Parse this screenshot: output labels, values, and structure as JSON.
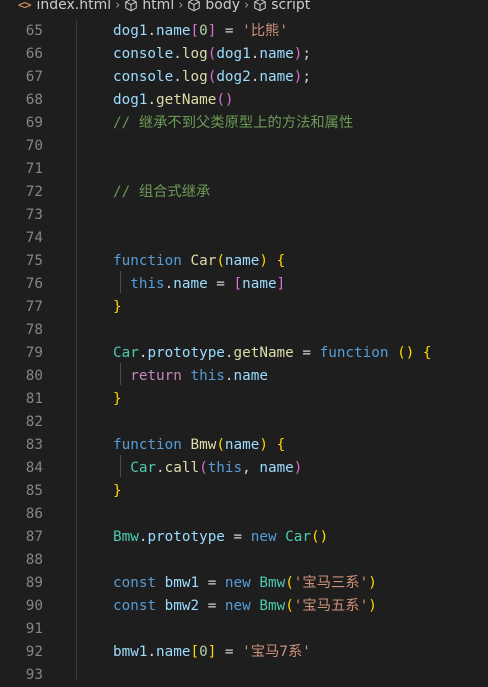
{
  "breadcrumb": {
    "file": "index.html",
    "html": "html",
    "body": "body",
    "script": "script",
    "file_icon": "code-angle-brackets-icon",
    "element_icon": "cube-icon"
  },
  "editor": {
    "lines": [
      {
        "n": "65",
        "tokens": [
          [
            "var",
            "dog1"
          ],
          [
            "plain",
            "."
          ],
          [
            "var",
            "name"
          ],
          [
            "br2",
            "["
          ],
          [
            "num",
            "0"
          ],
          [
            "br2",
            "]"
          ],
          [
            "plain",
            " = "
          ],
          [
            "str",
            "'比熊'"
          ]
        ]
      },
      {
        "n": "66",
        "tokens": [
          [
            "var",
            "console"
          ],
          [
            "plain",
            "."
          ],
          [
            "fn",
            "log"
          ],
          [
            "br2",
            "("
          ],
          [
            "var",
            "dog1"
          ],
          [
            "plain",
            "."
          ],
          [
            "var",
            "name"
          ],
          [
            "br2",
            ")"
          ],
          [
            "plain",
            ";"
          ]
        ]
      },
      {
        "n": "67",
        "tokens": [
          [
            "var",
            "console"
          ],
          [
            "plain",
            "."
          ],
          [
            "fn",
            "log"
          ],
          [
            "br2",
            "("
          ],
          [
            "var",
            "dog2"
          ],
          [
            "plain",
            "."
          ],
          [
            "var",
            "name"
          ],
          [
            "br2",
            ")"
          ],
          [
            "plain",
            ";"
          ]
        ]
      },
      {
        "n": "68",
        "tokens": [
          [
            "var",
            "dog1"
          ],
          [
            "plain",
            "."
          ],
          [
            "fn",
            "getName"
          ],
          [
            "br2",
            "()"
          ]
        ]
      },
      {
        "n": "69",
        "tokens": [
          [
            "cmt",
            "// 继承不到父类原型上的方法和属性"
          ]
        ]
      },
      {
        "n": "70",
        "tokens": []
      },
      {
        "n": "71",
        "tokens": []
      },
      {
        "n": "72",
        "tokens": [
          [
            "cmt",
            "// 组合式继承"
          ]
        ]
      },
      {
        "n": "73",
        "tokens": []
      },
      {
        "n": "74",
        "tokens": []
      },
      {
        "n": "75",
        "tokens": [
          [
            "kw",
            "function"
          ],
          [
            "plain",
            " "
          ],
          [
            "fn",
            "Car"
          ],
          [
            "br1",
            "("
          ],
          [
            "var",
            "name"
          ],
          [
            "br1",
            ")"
          ],
          [
            "plain",
            " "
          ],
          [
            "br1",
            "{"
          ]
        ]
      },
      {
        "n": "76",
        "tokens": [
          [
            "plain",
            "  "
          ],
          [
            "kw",
            "this"
          ],
          [
            "plain",
            "."
          ],
          [
            "var",
            "name"
          ],
          [
            "plain",
            " = "
          ],
          [
            "br2",
            "["
          ],
          [
            "var",
            "name"
          ],
          [
            "br2",
            "]"
          ]
        ]
      },
      {
        "n": "77",
        "tokens": [
          [
            "br1",
            "}"
          ]
        ]
      },
      {
        "n": "78",
        "tokens": []
      },
      {
        "n": "79",
        "tokens": [
          [
            "cls",
            "Car"
          ],
          [
            "plain",
            "."
          ],
          [
            "var",
            "prototype"
          ],
          [
            "plain",
            "."
          ],
          [
            "fn",
            "getName"
          ],
          [
            "plain",
            " = "
          ],
          [
            "kw",
            "function"
          ],
          [
            "plain",
            " "
          ],
          [
            "br1",
            "()"
          ],
          [
            "plain",
            " "
          ],
          [
            "br1",
            "{"
          ]
        ]
      },
      {
        "n": "80",
        "tokens": [
          [
            "plain",
            "  "
          ],
          [
            "kw2",
            "return"
          ],
          [
            "plain",
            " "
          ],
          [
            "kw",
            "this"
          ],
          [
            "plain",
            "."
          ],
          [
            "var",
            "name"
          ]
        ]
      },
      {
        "n": "81",
        "tokens": [
          [
            "br1",
            "}"
          ]
        ]
      },
      {
        "n": "82",
        "tokens": []
      },
      {
        "n": "83",
        "tokens": [
          [
            "kw",
            "function"
          ],
          [
            "plain",
            " "
          ],
          [
            "fn",
            "Bmw"
          ],
          [
            "br1",
            "("
          ],
          [
            "var",
            "name"
          ],
          [
            "br1",
            ")"
          ],
          [
            "plain",
            " "
          ],
          [
            "br1",
            "{"
          ]
        ]
      },
      {
        "n": "84",
        "tokens": [
          [
            "plain",
            "  "
          ],
          [
            "cls",
            "Car"
          ],
          [
            "plain",
            "."
          ],
          [
            "fn",
            "call"
          ],
          [
            "br2",
            "("
          ],
          [
            "kw",
            "this"
          ],
          [
            "plain",
            ", "
          ],
          [
            "var",
            "name"
          ],
          [
            "br2",
            ")"
          ]
        ]
      },
      {
        "n": "85",
        "tokens": [
          [
            "br1",
            "}"
          ]
        ]
      },
      {
        "n": "86",
        "tokens": []
      },
      {
        "n": "87",
        "tokens": [
          [
            "cls",
            "Bmw"
          ],
          [
            "plain",
            "."
          ],
          [
            "var",
            "prototype"
          ],
          [
            "plain",
            " = "
          ],
          [
            "kw",
            "new"
          ],
          [
            "plain",
            " "
          ],
          [
            "cls",
            "Car"
          ],
          [
            "br1",
            "()"
          ]
        ]
      },
      {
        "n": "88",
        "tokens": []
      },
      {
        "n": "89",
        "tokens": [
          [
            "kw",
            "const"
          ],
          [
            "plain",
            " "
          ],
          [
            "var",
            "bmw1"
          ],
          [
            "plain",
            " = "
          ],
          [
            "kw",
            "new"
          ],
          [
            "plain",
            " "
          ],
          [
            "cls",
            "Bmw"
          ],
          [
            "br1",
            "("
          ],
          [
            "str",
            "'宝马三系'"
          ],
          [
            "br1",
            ")"
          ]
        ]
      },
      {
        "n": "90",
        "tokens": [
          [
            "kw",
            "const"
          ],
          [
            "plain",
            " "
          ],
          [
            "var",
            "bmw2"
          ],
          [
            "plain",
            " = "
          ],
          [
            "kw",
            "new"
          ],
          [
            "plain",
            " "
          ],
          [
            "cls",
            "Bmw"
          ],
          [
            "br1",
            "("
          ],
          [
            "str",
            "'宝马五系'"
          ],
          [
            "br1",
            ")"
          ]
        ]
      },
      {
        "n": "91",
        "tokens": []
      },
      {
        "n": "92",
        "tokens": [
          [
            "var",
            "bmw1"
          ],
          [
            "plain",
            "."
          ],
          [
            "var",
            "name"
          ],
          [
            "br1",
            "["
          ],
          [
            "num",
            "0"
          ],
          [
            "br1",
            "]"
          ],
          [
            "plain",
            " = "
          ],
          [
            "str",
            "'宝马7系'"
          ]
        ]
      },
      {
        "n": "93",
        "tokens": []
      }
    ]
  },
  "colors": {
    "background": "#1e1e1e",
    "line_number": "#858585",
    "variable": "#9cdcfe",
    "keyword": "#569cd6",
    "control_keyword": "#c586c0",
    "function": "#dcdcaa",
    "class": "#4ec9b0",
    "string": "#ce9178",
    "number": "#b5cea8",
    "comment": "#6a9955",
    "bracket_level1": "#ffd700",
    "bracket_level2": "#da70d6"
  }
}
